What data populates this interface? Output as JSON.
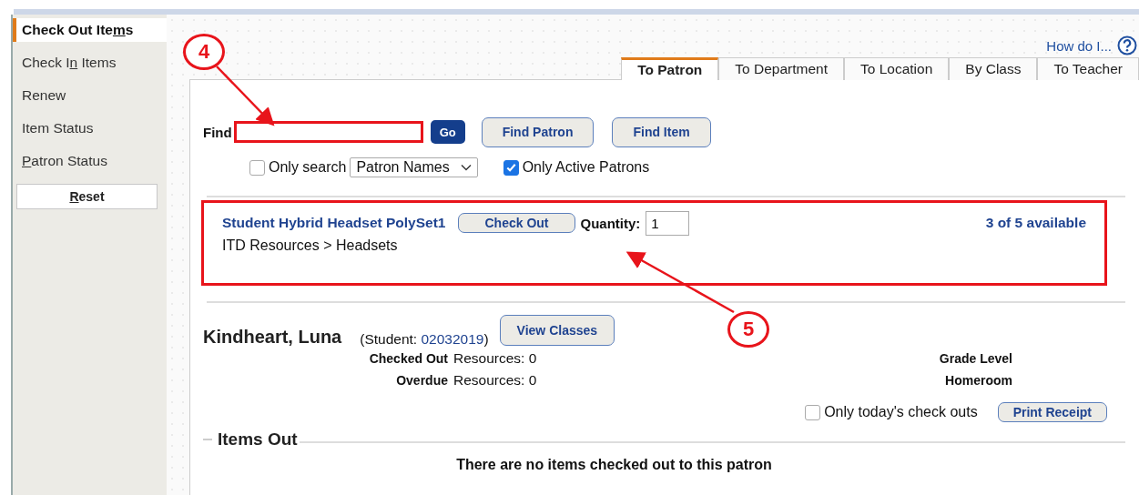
{
  "sidebar": {
    "items": [
      {
        "before": "Check Out Ite",
        "key": "m",
        "after": "s",
        "selected": true
      },
      {
        "before": "Check I",
        "key": "n",
        "after": " Items",
        "selected": false
      },
      {
        "before": "Renew",
        "selected": false
      },
      {
        "before": "Item Status",
        "selected": false
      },
      {
        "key": "P",
        "after": "atron Status",
        "selected": false
      }
    ],
    "reset": {
      "key": "R",
      "after": "eset"
    }
  },
  "help_link": "How do I...",
  "tabs": [
    {
      "label": "To Patron",
      "selected": true
    },
    {
      "label": "To Department",
      "selected": false
    },
    {
      "label": "To Location",
      "selected": false
    },
    {
      "label": "By Class",
      "selected": false
    },
    {
      "label": "To Teacher",
      "selected": false
    }
  ],
  "find": {
    "label": "Find",
    "go": "Go",
    "buttons": [
      "Find Patron",
      "Find Item"
    ]
  },
  "options": {
    "only_search": {
      "label": "Only search",
      "checked": false
    },
    "search_type": "Patron Names",
    "only_active": {
      "label": "Only Active Patrons",
      "checked": true
    }
  },
  "item": {
    "name": "Student Hybrid Headset PolySet1",
    "button": "Check Out",
    "quantity_label": "Quantity:",
    "quantity": "1",
    "availability": "3 of 5 available",
    "path": "ITD Resources > Headsets"
  },
  "patron": {
    "name": "Kindheart, Luna",
    "type_label": "(Student: ",
    "id": "02032019",
    "type_close": ")",
    "view_classes": "View Classes",
    "stats": [
      {
        "label": "Checked Out",
        "value": "Resources: 0",
        "right": "Grade Level"
      },
      {
        "label": "Overdue",
        "value": "Resources: 0",
        "right": "Homeroom"
      }
    ],
    "today": {
      "label": "Only today's check outs",
      "checked": false
    },
    "print": "Print Receipt"
  },
  "items_out": {
    "title": "Items Out",
    "message": "There are no items checked out to this patron"
  },
  "annotations": [
    {
      "label": "4"
    },
    {
      "label": "5"
    }
  ]
}
